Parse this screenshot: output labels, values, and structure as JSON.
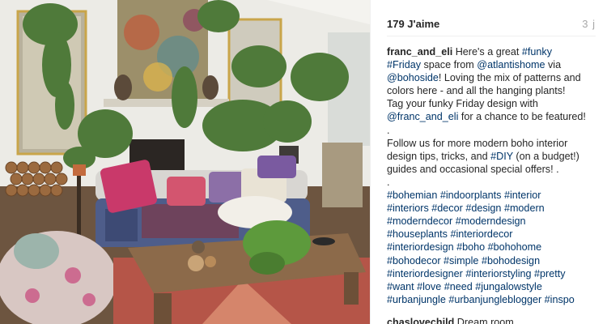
{
  "post": {
    "likes_label": "179 J'aime",
    "time_label": "3 j",
    "image_alt_icon": "boho-living-room-photo",
    "caption": {
      "username": "franc_and_eli",
      "l1_text": " Here's a great ",
      "l1_tag": "#funky",
      "l2_tag": "#Friday",
      "l2_text": " space from ",
      "l2_mention": "@atlantishome",
      "l2_text2": " via",
      "l3_mention": "@bohoside",
      "l3_text": "! Loving the mix of patterns and",
      "l4": "colors here - and all the hanging plants!",
      "l5": "Tag your funky Friday design with",
      "l6_mention": "@franc_and_eli",
      "l6_text": " for a chance to be featured!",
      "dot1": ".",
      "l7": "Follow us for more modern boho interior",
      "l8_text": "design tips, tricks, and ",
      "l8_tag": "#DIY",
      "l8_text2": " (on a budget!)",
      "l9": "guides and occasional special offers! .",
      "dot2": ".",
      "hashtag_lines": [
        "#bohemian #indoorplants #interior",
        "#interiors #decor #design #modern",
        "#moderndecor #moderndesign",
        "#houseplants #interiordecor",
        "#interiordesign #boho #bohohome",
        "#bohodecor #simple #bohodesign",
        "#interiordesigner #interiorstyling #pretty",
        "#want #love #need #jungalowstyle",
        "#urbanjungle #urbanjungleblogger #inspo"
      ]
    },
    "next_comment": {
      "username": "chaslovechild",
      "text": " Dream room"
    }
  },
  "colors": {
    "link": "#003569",
    "text": "#262626",
    "muted": "#a8a8a8"
  }
}
